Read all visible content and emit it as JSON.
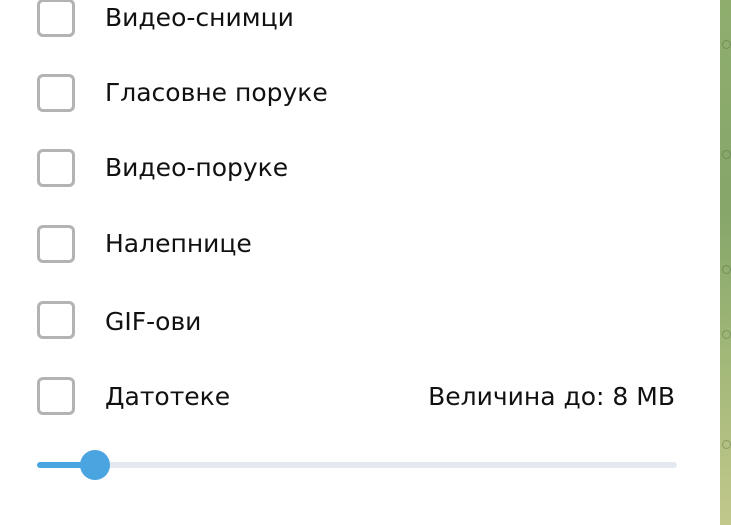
{
  "options": [
    {
      "label": "Видео-снимци",
      "checked": false
    },
    {
      "label": "Гласовне поруке",
      "checked": false
    },
    {
      "label": "Видео-поруке",
      "checked": false
    },
    {
      "label": "Налепнице",
      "checked": false
    },
    {
      "label": "GIF-ови",
      "checked": false
    },
    {
      "label": "Датотеке",
      "checked": false
    }
  ],
  "files": {
    "size_label": "Величина до: 8 MB",
    "slider_value_fraction": 0.09
  },
  "colors": {
    "accent": "#4aa4e0",
    "checkbox_border": "#b3b3b3",
    "track": "#e3e9ee",
    "text": "#111111"
  }
}
